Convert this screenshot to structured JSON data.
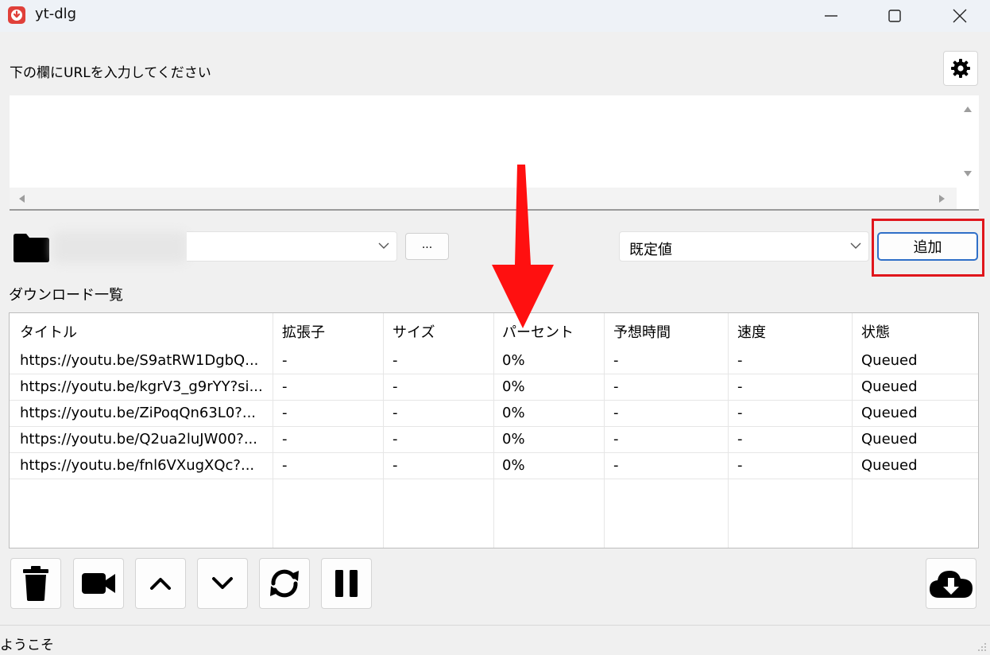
{
  "window": {
    "title": "yt-dlg",
    "minimize_icon": "minimize-icon",
    "maximize_icon": "maximize-icon",
    "close_icon": "close-icon"
  },
  "url_section": {
    "label": "下の欄にURLを入力してください",
    "value": "",
    "settings_icon": "gear-icon"
  },
  "download_options": {
    "folder_icon": "folder-icon",
    "path_value": "",
    "browse_label": "...",
    "format_value": "既定値",
    "add_label": "追加"
  },
  "download_list": {
    "label": "ダウンロード一覧",
    "columns": [
      "タイトル",
      "拡張子",
      "サイズ",
      "パーセント",
      "予想時間",
      "速度",
      "状態"
    ],
    "rows": [
      [
        "https://youtu.be/S9atRW1DgbQ...",
        "-",
        "-",
        "0%",
        "-",
        "-",
        "Queued"
      ],
      [
        "https://youtu.be/kgrV3_g9rYY?si...",
        "-",
        "-",
        "0%",
        "-",
        "-",
        "Queued"
      ],
      [
        "https://youtu.be/ZiPoqQn63L0?...",
        "-",
        "-",
        "0%",
        "-",
        "-",
        "Queued"
      ],
      [
        "https://youtu.be/Q2ua2luJW00?...",
        "-",
        "-",
        "0%",
        "-",
        "-",
        "Queued"
      ],
      [
        "https://youtu.be/fnl6VXugXQc?...",
        "-",
        "-",
        "0%",
        "-",
        "-",
        "Queued"
      ]
    ]
  },
  "toolbar": {
    "buttons": [
      "trash-icon",
      "video-icon",
      "chevron-up-icon",
      "chevron-down-icon",
      "reload-icon",
      "pause-icon"
    ],
    "download_icon": "cloud-download-icon"
  },
  "status": {
    "text": "ようこそ"
  },
  "colors": {
    "annotation_red": "#e0161c",
    "arrow_red": "#ff1010",
    "add_button_border": "#2f6fc8",
    "app_icon": "#e0403a"
  }
}
